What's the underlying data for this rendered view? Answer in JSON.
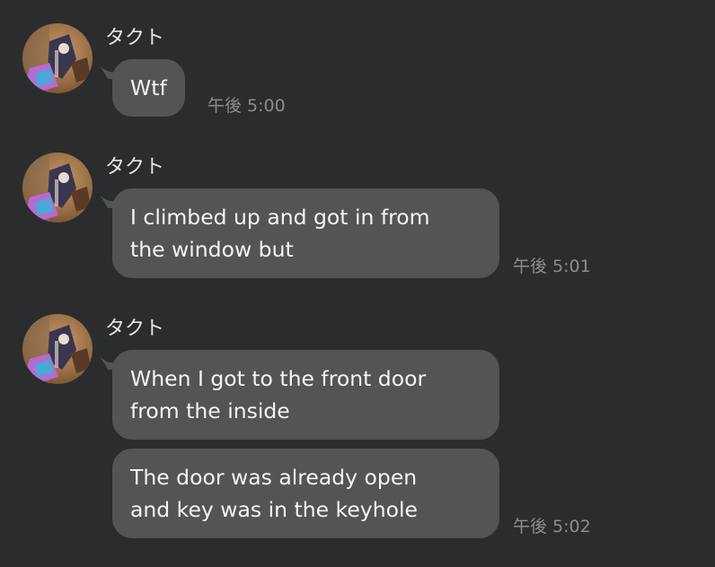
{
  "colors": {
    "background": "#2b2c2e",
    "bubble": "#545454",
    "text": "#f4f4f4",
    "timestamp": "#8d8d8d"
  },
  "groups": [
    {
      "sender": "タクト",
      "avatar_icon": "user-avatar-photo",
      "messages": [
        {
          "lines": [
            "Wtf"
          ]
        }
      ],
      "time": "午後 5:00"
    },
    {
      "sender": "タクト",
      "avatar_icon": "user-avatar-photo",
      "messages": [
        {
          "lines": [
            "I climbed up and got in from",
            "the window but"
          ]
        }
      ],
      "time": "午後 5:01"
    },
    {
      "sender": "タクト",
      "avatar_icon": "user-avatar-photo",
      "messages": [
        {
          "lines": [
            "When I got to the front door",
            "from the inside"
          ]
        },
        {
          "lines": [
            "The door was already open",
            "and key was in the keyhole"
          ]
        }
      ],
      "time": "午後 5:02"
    }
  ]
}
